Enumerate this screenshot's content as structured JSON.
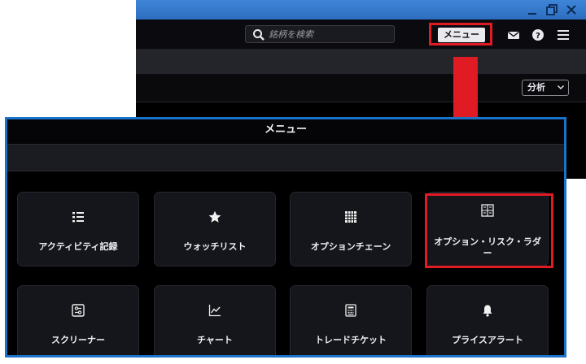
{
  "toolbar": {
    "search_placeholder": "銘柄を検索",
    "menu_label": "メニュー"
  },
  "subbar": {
    "analysis_label": "分析"
  },
  "panel": {
    "title": "メニュー",
    "items": [
      {
        "label": "アクティビティ記録",
        "icon": "list-icon"
      },
      {
        "label": "ウォッチリスト",
        "icon": "star-icon"
      },
      {
        "label": "オプションチェーン",
        "icon": "grid-icon"
      },
      {
        "label": "オプション・リスク・ラダー",
        "icon": "ladder-icon"
      },
      {
        "label": "スクリーナー",
        "icon": "screener-icon"
      },
      {
        "label": "チャート",
        "icon": "chart-icon"
      },
      {
        "label": "トレードチケット",
        "icon": "ticket-icon"
      },
      {
        "label": "プライスアラート",
        "icon": "bell-icon"
      }
    ]
  },
  "colors": {
    "highlight": "#e01b24",
    "panel_border": "#1a73c8",
    "titlebar": "#3f86d8"
  }
}
